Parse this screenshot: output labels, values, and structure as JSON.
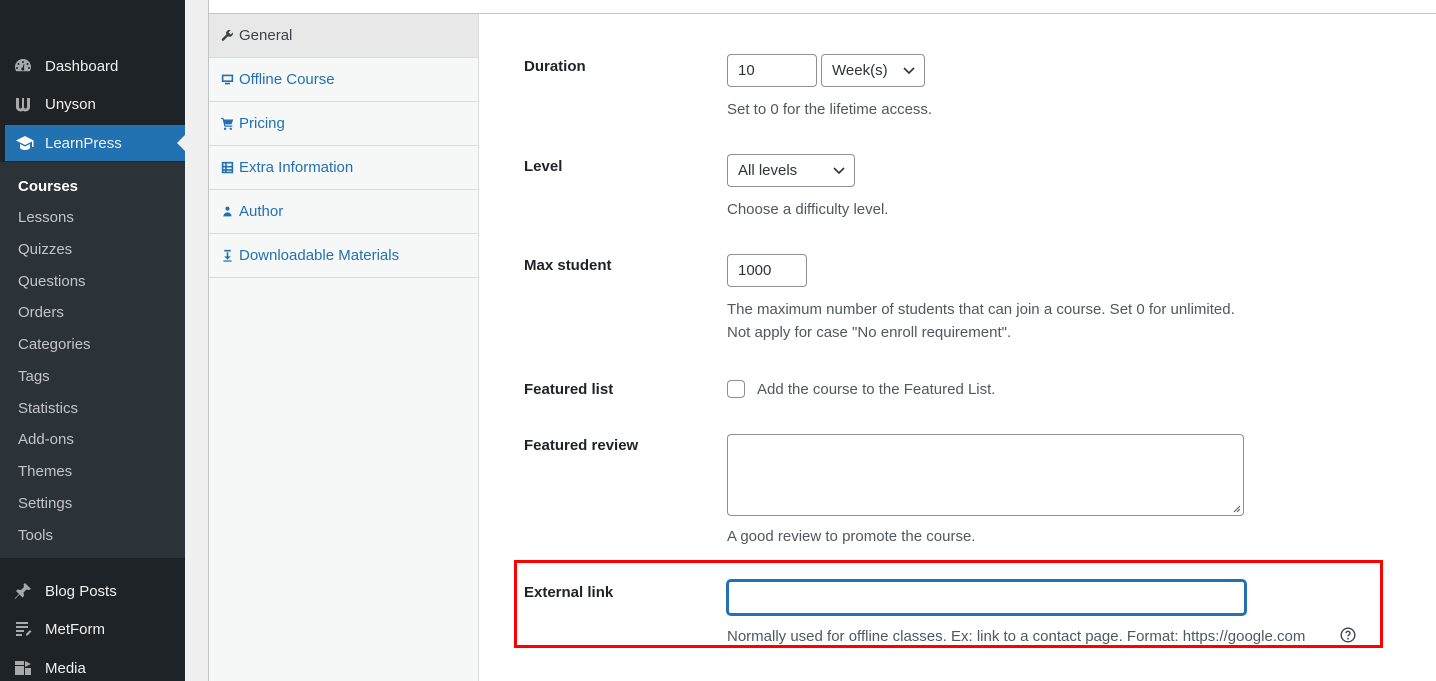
{
  "sidebar": {
    "menu": [
      {
        "label": "Dashboard",
        "icon": "dashboard-icon"
      },
      {
        "label": "Unyson",
        "icon": "unyson-icon"
      },
      {
        "label": "LearnPress",
        "icon": "graduation-cap-icon",
        "active": true
      }
    ],
    "submenu": [
      "Courses",
      "Lessons",
      "Quizzes",
      "Questions",
      "Orders",
      "Categories",
      "Tags",
      "Statistics",
      "Add-ons",
      "Themes",
      "Settings",
      "Tools"
    ],
    "submenu_current": "Courses",
    "menu_bottom": [
      {
        "label": "Blog Posts",
        "icon": "pin-icon"
      },
      {
        "label": "MetForm",
        "icon": "form-icon"
      },
      {
        "label": "Media",
        "icon": "media-icon"
      }
    ]
  },
  "tabs": [
    {
      "label": "General",
      "icon": "wrench-icon",
      "active": true
    },
    {
      "label": "Offline Course",
      "icon": "desktop-icon"
    },
    {
      "label": "Pricing",
      "icon": "cart-icon"
    },
    {
      "label": "Extra Information",
      "icon": "list-icon"
    },
    {
      "label": "Author",
      "icon": "users-icon"
    },
    {
      "label": "Downloadable Materials",
      "icon": "download-icon"
    }
  ],
  "fields": {
    "duration": {
      "label": "Duration",
      "value": "10",
      "unit": "Week(s)",
      "desc": "Set to 0 for the lifetime access."
    },
    "level": {
      "label": "Level",
      "value": "All levels",
      "desc": "Choose a difficulty level."
    },
    "max_student": {
      "label": "Max student",
      "value": "1000",
      "desc1": "The maximum number of students that can join a course. Set 0 for unlimited.",
      "desc2": "Not apply for case \"No enroll requirement\"."
    },
    "featured_list": {
      "label": "Featured list",
      "checkbox_label": "Add the course to the Featured List.",
      "checked": false
    },
    "featured_review": {
      "label": "Featured review",
      "value": "",
      "desc": "A good review to promote the course."
    },
    "external_link": {
      "label": "External link",
      "value": "",
      "desc": "Normally used for offline classes. Ex: link to a contact page. Format: https://google.com"
    }
  },
  "colors": {
    "accent": "#2271b1",
    "sidebar_bg": "#1d2327",
    "highlight": "#ff0000"
  }
}
